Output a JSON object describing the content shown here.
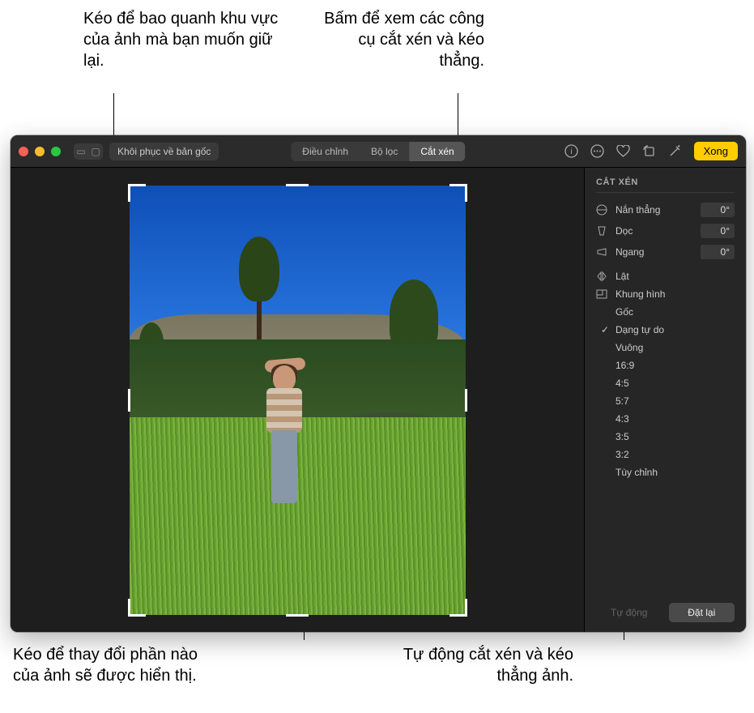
{
  "annotations": {
    "top_left": "Kéo để bao quanh khu vực của ảnh mà bạn muốn giữ lại.",
    "top_right": "Bấm để xem các công cụ cắt xén và kéo thẳng.",
    "bottom_left": "Kéo để thay đổi phần nào của ảnh sẽ được hiển thị.",
    "bottom_right": "Tự động cắt xén và kéo thẳng ảnh."
  },
  "toolbar": {
    "revert": "Khôi phục về bản gốc",
    "tabs": {
      "adjust": "Điều chỉnh",
      "filters": "Bộ lọc",
      "crop": "Cắt xén"
    },
    "done": "Xong"
  },
  "sidebar": {
    "title": "CẮT XÉN",
    "straighten": {
      "label": "Nắn thẳng",
      "value": "0°"
    },
    "vertical": {
      "label": "Dọc",
      "value": "0°"
    },
    "horizontal": {
      "label": "Ngang",
      "value": "0°"
    },
    "flip": "Lật",
    "aspect_header": "Khung hình",
    "aspects": {
      "original": "Gốc",
      "freeform": "Dạng tự do",
      "square": "Vuông",
      "r169": "16:9",
      "r45": "4:5",
      "r57": "5:7",
      "r43": "4:3",
      "r35": "3:5",
      "r32": "3:2",
      "custom": "Tùy chỉnh"
    },
    "auto": "Tự động",
    "reset": "Đặt lại"
  }
}
